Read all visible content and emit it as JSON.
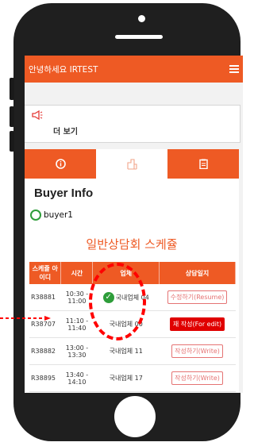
{
  "header": {
    "greeting": "안녕하세요 IRTEST"
  },
  "notice": {
    "more_label": "더 보기"
  },
  "icons": {
    "menu": "hamburger-icon",
    "notice": "megaphone-icon",
    "info": "info-icon",
    "building": "building-icon",
    "document": "document-icon",
    "check": "check-icon"
  },
  "buyer": {
    "heading": "Buyer Info",
    "name": "buyer1"
  },
  "schedule": {
    "title": "일반상담회 스케쥴",
    "columns": [
      "스케쥴 아이디",
      "시간",
      "업체",
      "상담일지"
    ],
    "rows": [
      {
        "id": "R38881",
        "time": "10:30 - 11:00",
        "company": "국내업체 04",
        "action": "수정하기(Resume)",
        "checked": true,
        "action_style": "outline"
      },
      {
        "id": "R38707",
        "time": "11:10 - 11:40",
        "company": "국내업체 00",
        "action": "재 작성(For edit)",
        "checked": false,
        "action_style": "filled"
      },
      {
        "id": "R38882",
        "time": "13:00 - 13:30",
        "company": "국내업체 11",
        "action": "작성하기(Write)",
        "checked": false,
        "action_style": "outline"
      },
      {
        "id": "R38895",
        "time": "13:40 - 14:10",
        "company": "국내업체 17",
        "action": "작성하기(Write)",
        "checked": false,
        "action_style": "outline"
      }
    ]
  },
  "colors": {
    "accent": "#ee5a24",
    "highlight": "#ff0000",
    "success": "#2e9d3a"
  }
}
